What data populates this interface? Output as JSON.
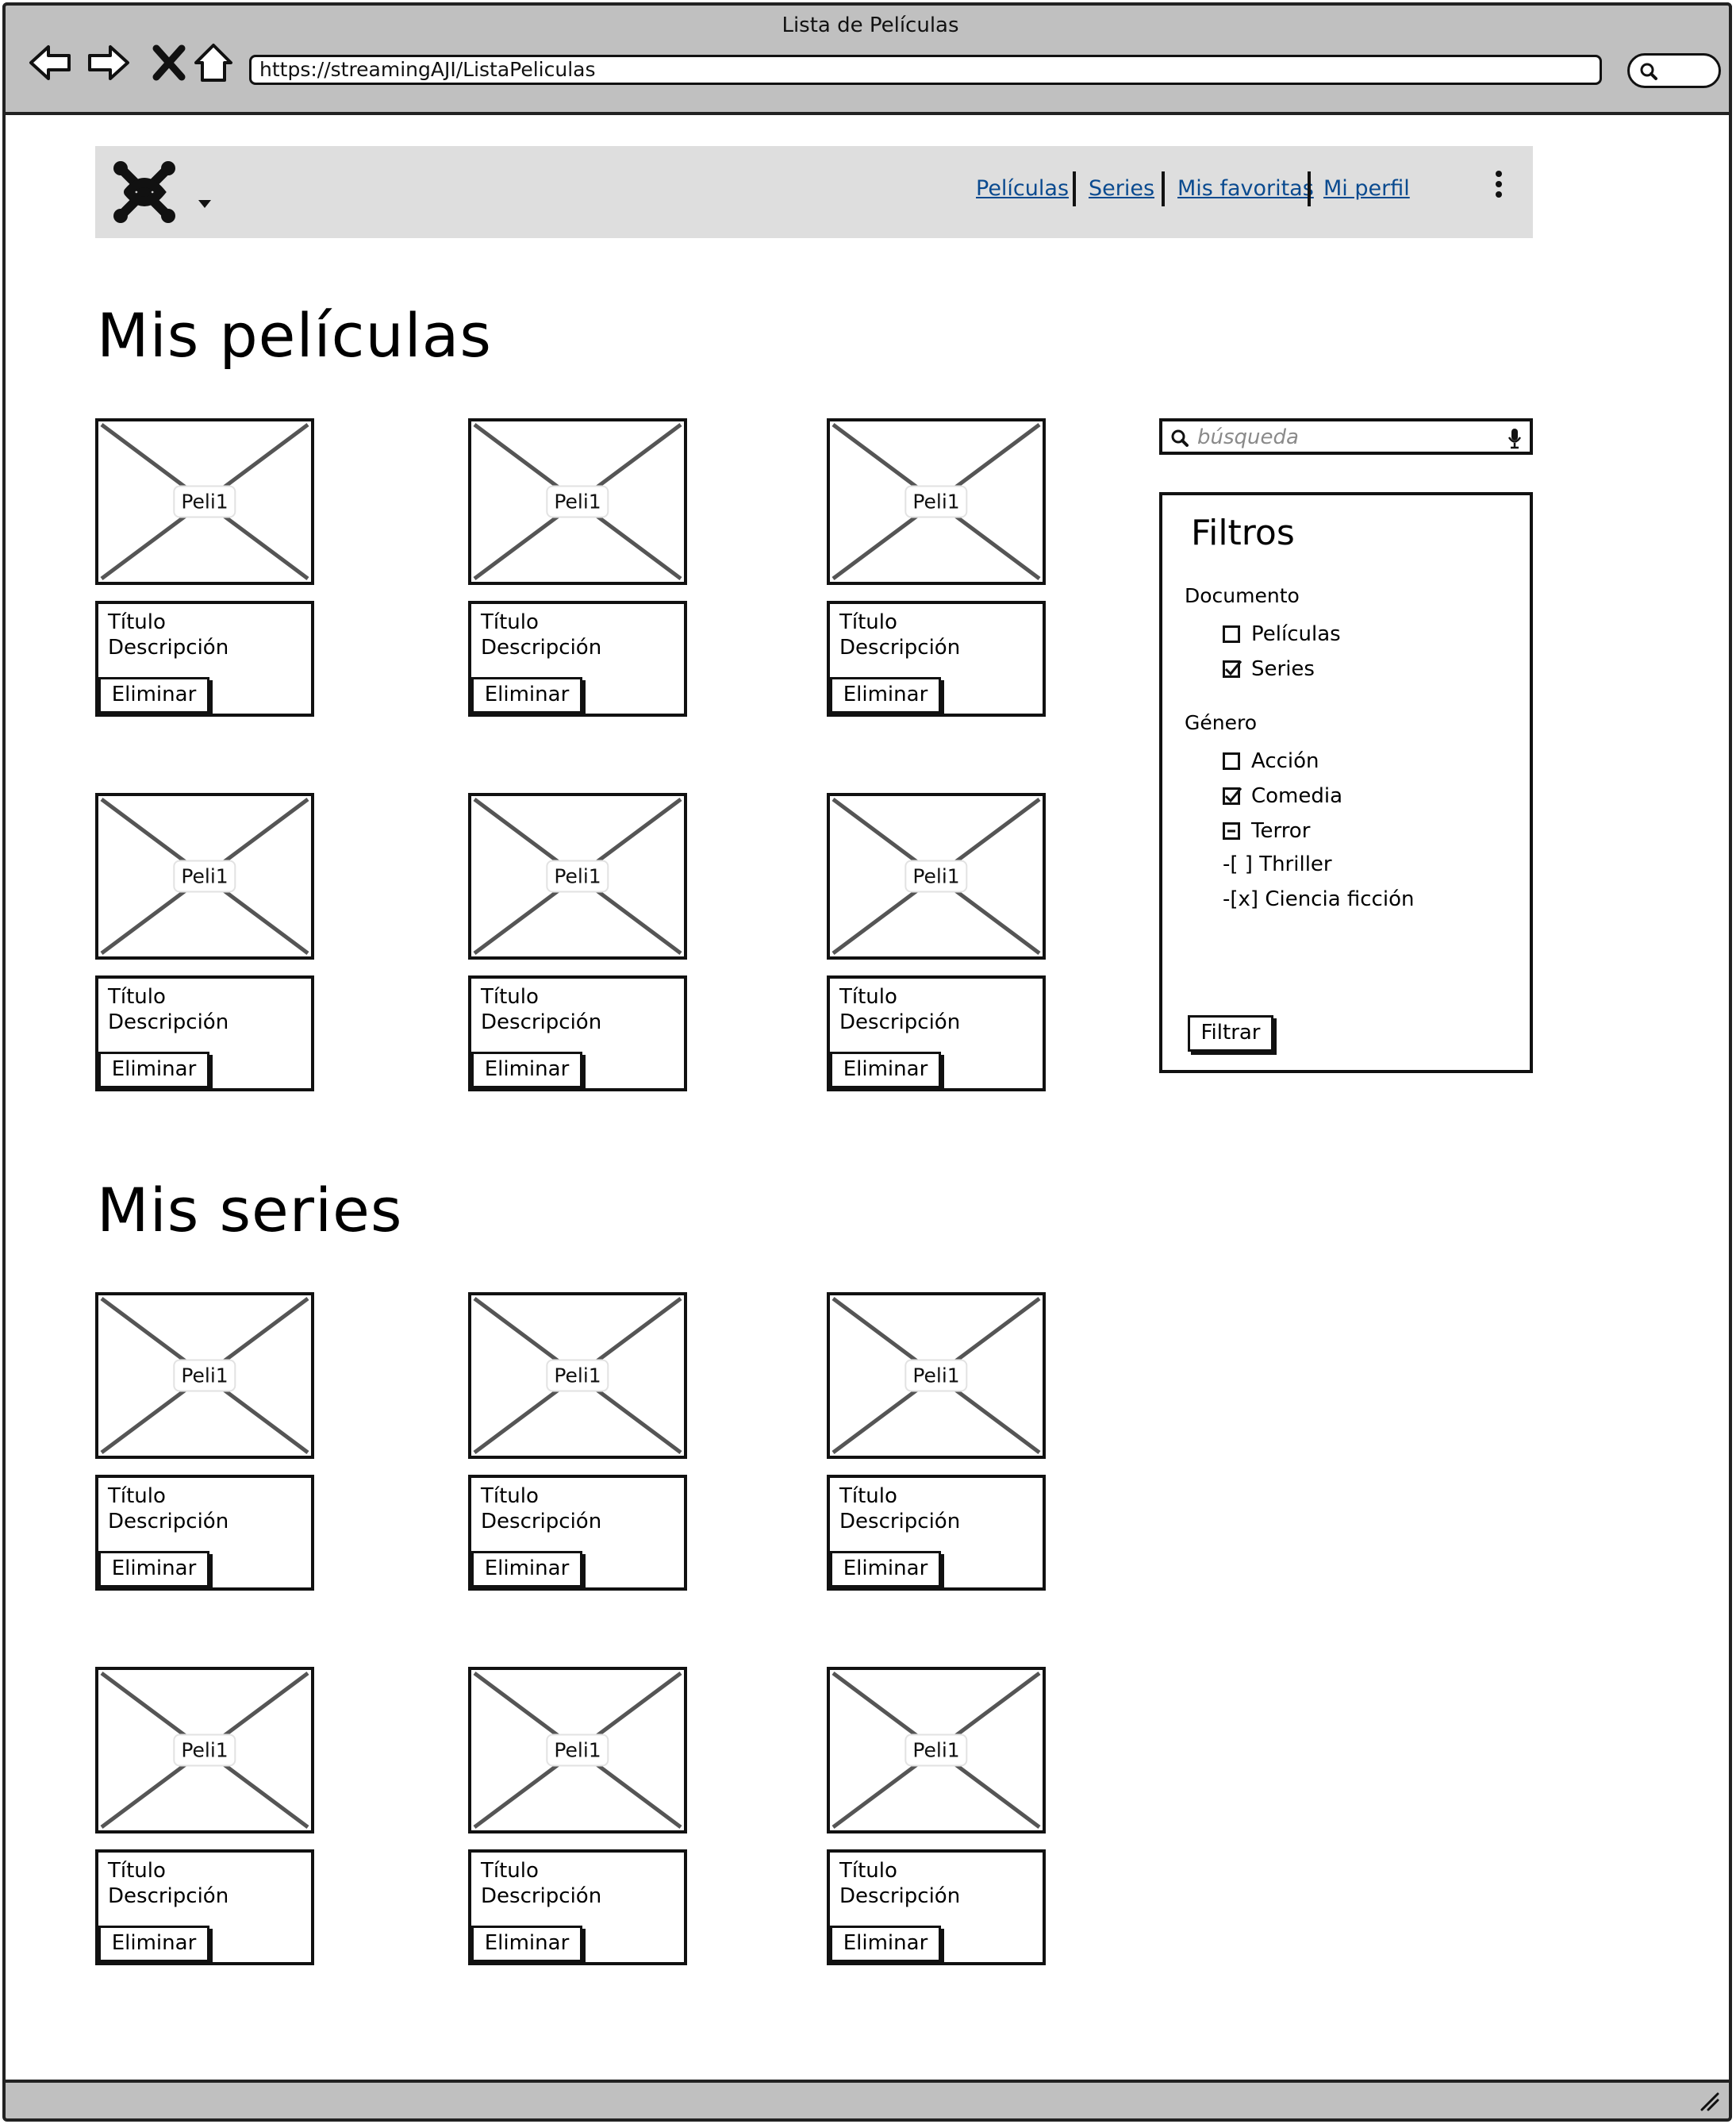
{
  "browser": {
    "window_title": "Lista de Películas",
    "url": "https://streamingAJI/ListaPeliculas"
  },
  "header": {
    "nav": [
      "Películas",
      "Series",
      "Mis favoritas",
      "Mi perfil"
    ]
  },
  "movies_section": {
    "title": "Mis películas",
    "cards": [
      {
        "image_label": "Peli1",
        "title": "Título",
        "description": "Descripción",
        "button": "Eliminar"
      },
      {
        "image_label": "Peli1",
        "title": "Título",
        "description": "Descripción",
        "button": "Eliminar"
      },
      {
        "image_label": "Peli1",
        "title": "Título",
        "description": "Descripción",
        "button": "Eliminar"
      },
      {
        "image_label": "Peli1",
        "title": "Título",
        "description": "Descripción",
        "button": "Eliminar"
      },
      {
        "image_label": "Peli1",
        "title": "Título",
        "description": "Descripción",
        "button": "Eliminar"
      },
      {
        "image_label": "Peli1",
        "title": "Título",
        "description": "Descripción",
        "button": "Eliminar"
      }
    ]
  },
  "series_section": {
    "title": "Mis series",
    "cards": [
      {
        "image_label": "Peli1",
        "title": "Título",
        "description": "Descripción",
        "button": "Eliminar"
      },
      {
        "image_label": "Peli1",
        "title": "Título",
        "description": "Descripción",
        "button": "Eliminar"
      },
      {
        "image_label": "Peli1",
        "title": "Título",
        "description": "Descripción",
        "button": "Eliminar"
      },
      {
        "image_label": "Peli1",
        "title": "Título",
        "description": "Descripción",
        "button": "Eliminar"
      },
      {
        "image_label": "Peli1",
        "title": "Título",
        "description": "Descripción",
        "button": "Eliminar"
      },
      {
        "image_label": "Peli1",
        "title": "Título",
        "description": "Descripción",
        "button": "Eliminar"
      }
    ]
  },
  "search": {
    "placeholder": "búsqueda"
  },
  "filters": {
    "title": "Filtros",
    "document_label": "Documento",
    "document_options": [
      {
        "label": "Películas",
        "state": "unchecked"
      },
      {
        "label": "Series",
        "state": "checked"
      }
    ],
    "genre_label": "Género",
    "genre_options": [
      {
        "label": "Acción",
        "state": "unchecked"
      },
      {
        "label": "Comedia",
        "state": "checked"
      },
      {
        "label": "Terror",
        "state": "indeterminate"
      }
    ],
    "genre_text_options": [
      "-[ ] Thriller",
      "-[x] Ciencia ficción"
    ],
    "button": "Filtrar"
  },
  "icons": [
    "back-arrow-icon",
    "forward-arrow-icon",
    "stop-icon",
    "home-icon",
    "search-icon",
    "microphone-icon",
    "logo-icon",
    "chevron-down-icon",
    "kebab-menu-icon",
    "resize-grip-icon"
  ],
  "colors": {
    "chrome": "#c0c0c0",
    "header_bg": "#dedede",
    "link": "#0a4a8f"
  }
}
